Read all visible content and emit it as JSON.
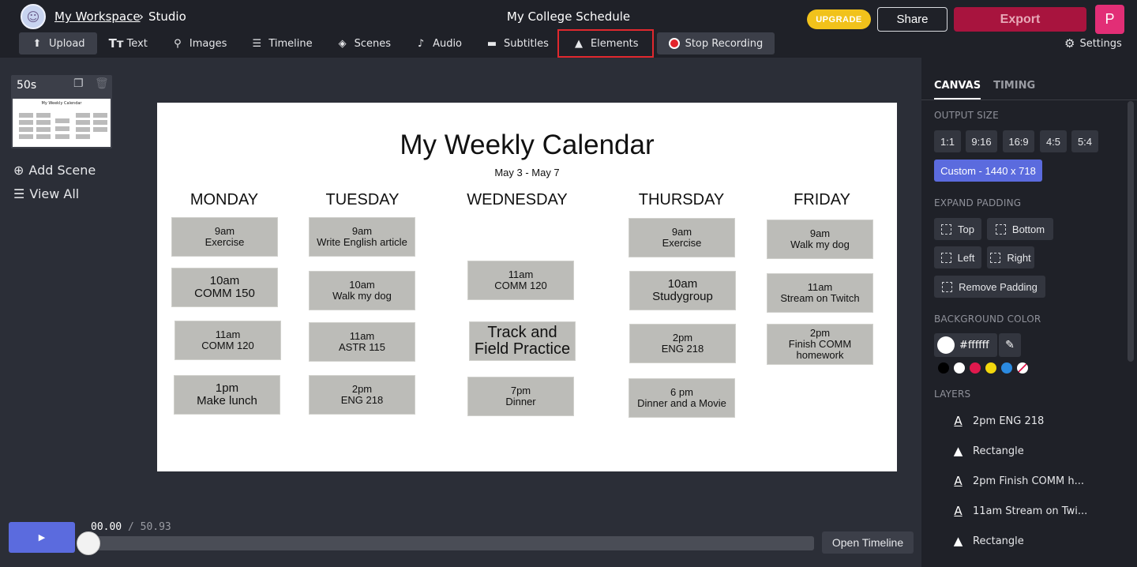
{
  "header": {
    "workspace": "My Workspace",
    "crumb_sep": "›",
    "studio": "Studio",
    "project_title": "My College Schedule",
    "upgrade": "UPGRADE",
    "share": "Share",
    "export": "Export",
    "profile_initial": "P"
  },
  "toolbar": {
    "upload": "Upload",
    "text": "Text",
    "images": "Images",
    "timeline": "Timeline",
    "scenes": "Scenes",
    "audio": "Audio",
    "subtitles": "Subtitles",
    "elements": "Elements",
    "stop_recording": "Stop Recording",
    "settings": "Settings"
  },
  "scenes": {
    "duration": "50s",
    "add_scene": "Add Scene",
    "view_all": "View All"
  },
  "canvas": {
    "title": "My Weekly Calendar",
    "subtitle": "May 3 - May 7",
    "days": [
      "MONDAY",
      "TUESDAY",
      "WEDNESDAY",
      "THURSDAY",
      "FRIDAY"
    ],
    "events": {
      "mon": [
        "9am\nExercise",
        "10am\nCOMM 150",
        "11am\nCOMM 120",
        "1pm\nMake lunch"
      ],
      "tue": [
        "9am\nWrite English article",
        "10am\nWalk my dog",
        "11am\nASTR 115",
        "2pm\nENG 218"
      ],
      "wed": [
        "11am\nCOMM 120",
        "Track and\nField Practice",
        "7pm\nDinner"
      ],
      "thu": [
        "9am\nExercise",
        "10am\nStudygroup",
        "2pm\nENG 218",
        "6 pm\nDinner and a Movie"
      ],
      "fri": [
        "9am\nWalk my dog",
        "11am\nStream on Twitch",
        "2pm\nFinish COMM\nhomework"
      ]
    }
  },
  "playback": {
    "current": "00.00",
    "separator": "/",
    "total": "50.93",
    "progress": 0,
    "open_timeline": "Open Timeline"
  },
  "panel": {
    "tabs": [
      "CANVAS",
      "TIMING"
    ],
    "output_size_label": "OUTPUT SIZE",
    "sizes": [
      "1:1",
      "9:16",
      "16:9",
      "4:5",
      "5:4"
    ],
    "custom_size": "Custom - 1440 x 718",
    "expand_padding_label": "EXPAND PADDING",
    "padding": [
      "Top",
      "Bottom",
      "Left",
      "Right",
      "Remove Padding"
    ],
    "background_color_label": "BACKGROUND COLOR",
    "bg_hex": "#ffffff",
    "palette": [
      "#000000",
      "#ffffff",
      "#e0194d",
      "#f2d70d",
      "#2b8ae0",
      "#e8a0a8"
    ],
    "layers_label": "LAYERS",
    "layers": [
      {
        "icon": "text-icon",
        "label": "2pm ENG 218"
      },
      {
        "icon": "shapes-icon",
        "label": "Rectangle"
      },
      {
        "icon": "text-icon",
        "label": "2pm Finish COMM h..."
      },
      {
        "icon": "text-icon",
        "label": "11am Stream on Twi..."
      },
      {
        "icon": "shapes-icon",
        "label": "Rectangle"
      }
    ]
  }
}
